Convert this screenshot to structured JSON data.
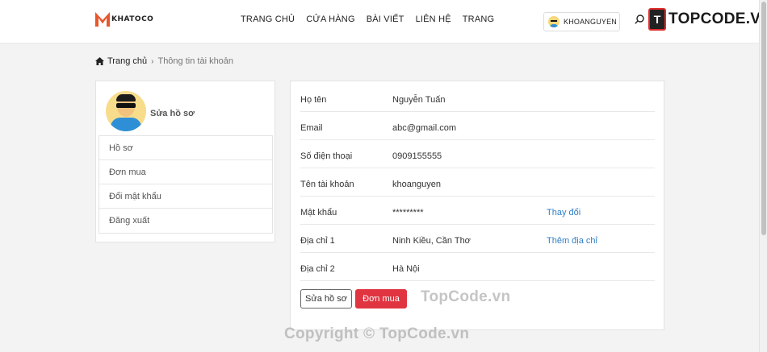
{
  "header": {
    "logo_text": "KHATOCO",
    "nav": [
      "TRANG CHỦ",
      "CỬA HÀNG",
      "BÀI VIẾT",
      "LIÊN HỆ",
      "TRANG"
    ],
    "user_name": "KHOANGUYEN",
    "brand_watermark": "TOPCODE.VN",
    "brand_box_glyph": "T",
    "icons": {
      "logo": "m-logo-icon",
      "search": "search-icon",
      "user": "user-avatar-icon"
    }
  },
  "breadcrumb": {
    "home": "Trang chủ",
    "separator": "›",
    "current": "Thông tin tài khoản"
  },
  "profile": {
    "edit_label": "Sửa hồ sơ",
    "menu": [
      "Hồ sơ",
      "Đơn mua",
      "Đổi mật khẩu",
      "Đăng xuất"
    ]
  },
  "account": {
    "rows": [
      {
        "label": "Họ tên",
        "value": "Nguyễn Tuấn",
        "action": ""
      },
      {
        "label": "Email",
        "value": "abc@gmail.com",
        "action": ""
      },
      {
        "label": "Số điện thoại",
        "value": "0909155555",
        "action": ""
      },
      {
        "label": "Tên tài khoản",
        "value": "khoanguyen",
        "action": ""
      },
      {
        "label": "Mật khẩu",
        "value": "*********",
        "action": "Thay đổi"
      },
      {
        "label": "Địa chỉ 1",
        "value": "Ninh Kiều, Cần Thơ",
        "action": "Thêm địa chỉ"
      },
      {
        "label": "Địa chỉ 2",
        "value": "Hà Nội",
        "action": ""
      }
    ],
    "edit_button": "Sửa hồ sơ",
    "orders_button": "Đơn mua"
  },
  "watermarks": {
    "center": "TopCode.vn",
    "bottom": "Copyright © TopCode.vn"
  },
  "colors": {
    "accent_red": "#e03440",
    "link_blue": "#2f7ec7",
    "logo_orange": "#e8562c"
  }
}
